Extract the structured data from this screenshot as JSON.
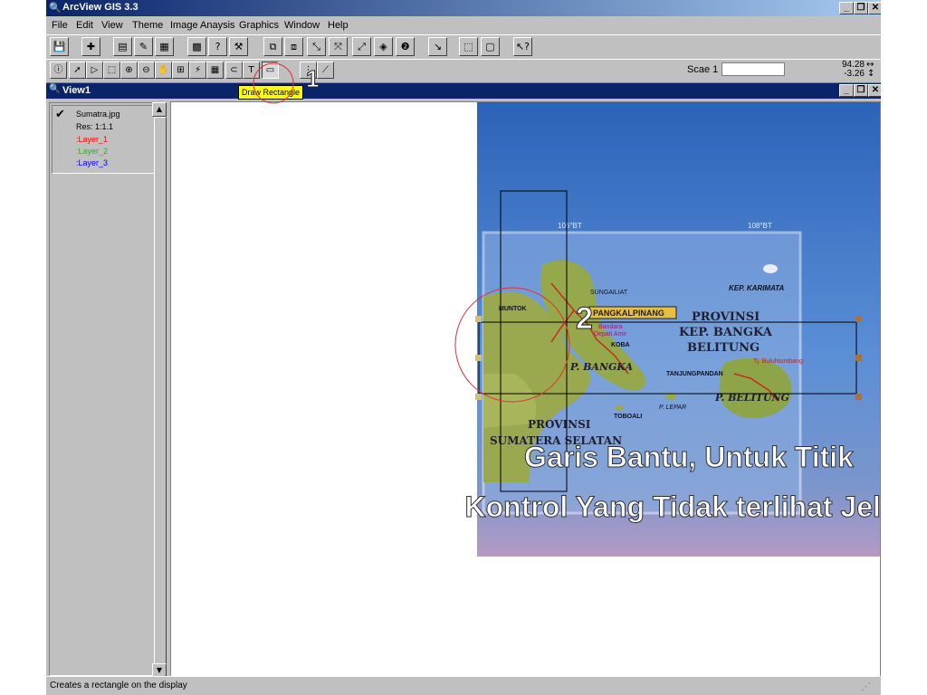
{
  "app": {
    "title": "ArcView GIS 3.3",
    "window_buttons": [
      "_",
      "ô",
      "×"
    ]
  },
  "menu": [
    "File",
    "Edit",
    "View",
    "Theme",
    "Image Anaysis",
    "Graphics",
    "Window",
    "Help"
  ],
  "toolbar2": {
    "scale_label": "Scae 1",
    "scale_value": "",
    "coord_x": "94.28",
    "coord_y": "-3.26"
  },
  "tooltip": "Draw Rectangle",
  "view": {
    "title": "View1"
  },
  "legend": {
    "items": [
      {
        "label": "Sumatra.jpg",
        "checked": true,
        "color": "#000000"
      },
      {
        "label": "Res: 1:1.1",
        "checked": false,
        "color": "#000000"
      },
      {
        "label": ":Layer_1",
        "checked": false,
        "color": "#ff0000"
      },
      {
        "label": ":Layer_2",
        "checked": false,
        "color": "#00cc00"
      },
      {
        "label": ":Layer_3",
        "checked": false,
        "color": "#0000ff"
      }
    ]
  },
  "annotations": {
    "step1": "1",
    "step2": "2",
    "caption_line1": "Garis Bantu, Untuk Titik",
    "caption_line2": "Kontrol Yang Tidak terlihat Jelas"
  },
  "map_labels": {
    "provinsi1": "PROVINSI",
    "kep_bangka": "KEP. BANGKA",
    "belitung": "BELITUNG",
    "kep_karimata": "KEP. KARIMATA",
    "sungailiat": "SUNGAILIAT",
    "pangkalpinang": "PANGKALPINANG",
    "bandara": "Bandara",
    "depati_amir": "Depati Amir",
    "koba": "KOBA",
    "p_bangka": "P. BANGKA",
    "tanjungpandan": "TANJUNGPANDAN",
    "tj_buluhtumbang": "Tj. Buluhtumbang",
    "p_belitung": "P. BELITUNG",
    "p_lepar": "P. LEPAR",
    "toboali": "TOBOALI",
    "provinsi2": "PROVINSI",
    "sumatera_selatan": "SUMATERA SELATAN",
    "muntok": "MUNTOK",
    "lon1": "106°BT",
    "lon2": "108°BT"
  },
  "status": "Creates a rectangle on the display",
  "colors": {
    "titlebar": "#0a246a",
    "tooltip_bg": "#ffff00",
    "annotation_circle": "#e03030",
    "map_sea": "#3f78c8",
    "map_land": "#9aa850"
  }
}
